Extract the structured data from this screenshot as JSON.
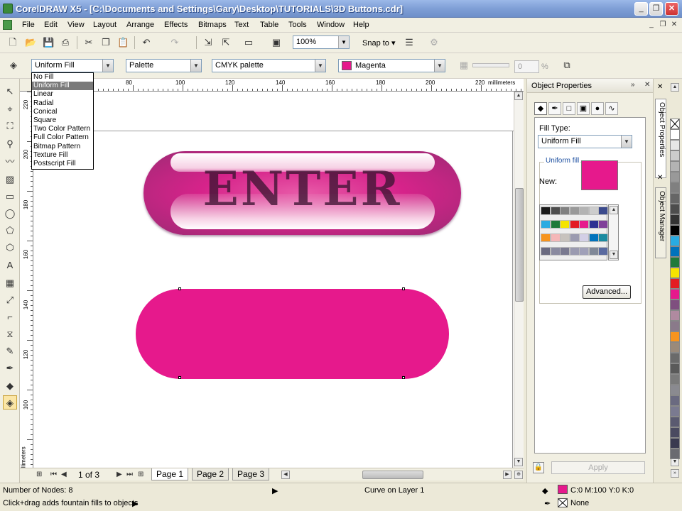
{
  "window": {
    "title": "CorelDRAW X5 - [C:\\Documents and Settings\\Gary\\Desktop\\TUTORIALS\\3D Buttons.cdr]",
    "minimize": "_",
    "restore": "❐",
    "close": "✕",
    "mdi_minimize": "_",
    "mdi_restore": "❐",
    "mdi_close": "✕"
  },
  "menu": {
    "items": [
      {
        "label": "File",
        "mnemonic": "F"
      },
      {
        "label": "Edit",
        "mnemonic": "E"
      },
      {
        "label": "View",
        "mnemonic": "V"
      },
      {
        "label": "Layout",
        "mnemonic": "L"
      },
      {
        "label": "Arrange",
        "mnemonic": "A"
      },
      {
        "label": "Effects",
        "mnemonic": "C"
      },
      {
        "label": "Bitmaps",
        "mnemonic": "B"
      },
      {
        "label": "Text",
        "mnemonic": "X"
      },
      {
        "label": "Table",
        "mnemonic": "T"
      },
      {
        "label": "Tools",
        "mnemonic": "O"
      },
      {
        "label": "Window",
        "mnemonic": "W"
      },
      {
        "label": "Help",
        "mnemonic": "H"
      }
    ]
  },
  "toolbar": {
    "icons": [
      "new-icon",
      "open-icon",
      "save-icon",
      "print-icon",
      "cut-icon",
      "copy-icon",
      "paste-icon",
      "undo-icon",
      "redo-icon",
      "import-icon",
      "export-icon",
      "app-launcher-icon",
      "welcome-screen-icon",
      "options-icon"
    ],
    "zoom": "100%",
    "snap_to": "Snap to"
  },
  "property_bar": {
    "fill_type": "Uniform Fill",
    "palette_type": "Palette",
    "palette_name": "CMYK palette",
    "color_name": "Magenta",
    "tint_value": "0",
    "tint_unit": "%"
  },
  "fill_dropdown": {
    "options": [
      "No Fill",
      "Uniform Fill",
      "Linear",
      "Radial",
      "Conical",
      "Square",
      "Two Color Pattern",
      "Full Color Pattern",
      "Bitmap Pattern",
      "Texture Fill",
      "Postscript Fill"
    ],
    "selected": "Uniform Fill"
  },
  "rulers": {
    "h_labels": [
      "80",
      "100",
      "120",
      "140",
      "160",
      "180",
      "200",
      "220"
    ],
    "h_unit": "millimeters",
    "v_labels": [
      "220",
      "200",
      "180",
      "160",
      "140",
      "120",
      "100"
    ],
    "v_unit": "millimeters"
  },
  "canvas": {
    "button_text": "ENTER"
  },
  "page_nav": {
    "page_count": "1 of 3",
    "tabs": [
      "Page 1",
      "Page 2",
      "Page 3"
    ]
  },
  "docker": {
    "title": "Object Properties",
    "fill_type_label": "Fill Type:",
    "fill_type_value": "Uniform Fill",
    "group_label": "Uniform fill",
    "new_label": "New:",
    "advanced_button": "Advanced...",
    "apply_button": "Apply",
    "side_tabs": [
      "Object Properties",
      "Object Manager"
    ],
    "new_color": "#e6198c"
  },
  "colors": {
    "magenta": "#e6198c",
    "grid_swatches": [
      "#1a1a1a",
      "#4d4d4d",
      "#808080",
      "#999999",
      "#b3b3b3",
      "#cccccc",
      "#3b4a8c",
      "#29abe2",
      "#1f7a3a",
      "#f5e400",
      "#e31b23",
      "#e6198c",
      "#2e3192",
      "#7f3f98",
      "#f7941d",
      "#f4b7b8",
      "#c7c2bd",
      "#9b9bb0",
      "#d3cfe6",
      "#0072bc",
      "#1a8aa0",
      "#6a6a80",
      "#8a8aa0",
      "#7a7a90",
      "#9a9ab0",
      "#a0a0b8",
      "#808898",
      "#5a6aa0"
    ],
    "palette_swatches": [
      "none",
      "#ffffff",
      "#e6e6e6",
      "#cccccc",
      "#b3b3b3",
      "#999999",
      "#808080",
      "#666666",
      "#4d4d4d",
      "#333333",
      "#000000",
      "#29abe2",
      "#0072bc",
      "#1f7a3a",
      "#f5e400",
      "#e31b23",
      "#e6198c",
      "#7f4f7f",
      "#b08aa0",
      "#8a7a8a",
      "#f7941d",
      "#9a8a7a",
      "#6a6a6a",
      "#5a5a5a",
      "#7a7a7a",
      "#8a8a90",
      "#6a6a80",
      "#7a7a90",
      "#5a5a70",
      "#4a4a60",
      "#3a3a50",
      "#6a6a70"
    ]
  },
  "status": {
    "nodes": "Number of Nodes: 8",
    "hint": "Click+drag adds fountain fills to objects",
    "object": "Curve on Layer 1",
    "fill_info": "C:0 M:100 Y:0 K:0",
    "outline_info": "None"
  }
}
